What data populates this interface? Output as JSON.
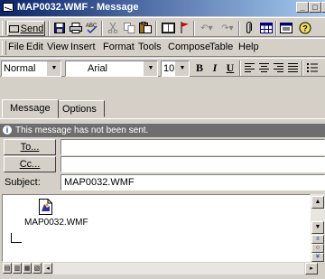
{
  "window": {
    "title": "MAP0032.WMF - Message",
    "buttons": {
      "minimize": "_",
      "maximize": "□",
      "close": "x"
    }
  },
  "toolbar": {
    "send_label": "Send",
    "items": [
      "save-icon",
      "print-icon",
      "spell-check-icon",
      "cut-icon",
      "copy-icon",
      "paste-icon",
      "address-book-icon",
      "flag-icon",
      "undo-icon",
      "redo-icon",
      "attach-icon",
      "table-icon",
      "view-icon",
      "help-icon"
    ]
  },
  "menu": {
    "file": "File",
    "edit": "Edit",
    "view": "View",
    "insert": "Insert",
    "format": "Format",
    "tools": "Tools",
    "compose": "Compose",
    "table": "Table",
    "help": "Help"
  },
  "format_bar": {
    "style": "Normal",
    "font": "Arial",
    "size": "10",
    "bold": "B",
    "italic": "I",
    "underline": "U"
  },
  "tabs": {
    "message": "Message",
    "options": "Options"
  },
  "infobar": {
    "text": "This message has not been sent."
  },
  "address": {
    "to_label": "To...",
    "cc_label": "Cc...",
    "subject_label": "Subject:",
    "subject_value": "MAP0032.WMF"
  },
  "attachment": {
    "filename": "MAP0032.WMF"
  },
  "colors": {
    "title_start": "#0a246a",
    "title_end": "#a6caf0",
    "face": "#d4d0c8",
    "infobar": "#6e6e6e"
  }
}
